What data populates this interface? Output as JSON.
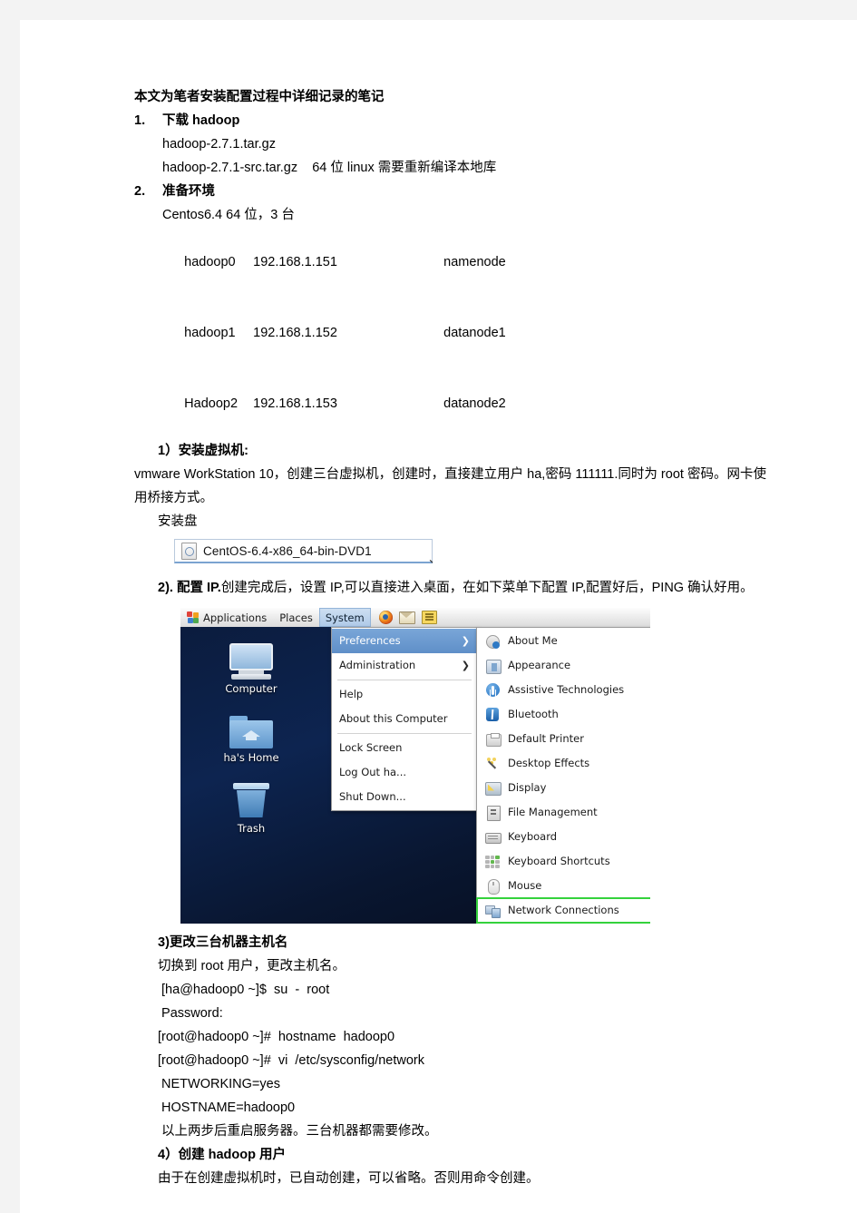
{
  "document": {
    "intro": "本文为笔者安装配置过程中详细记录的笔记",
    "sections": [
      {
        "number": "1.",
        "title": "下载 hadoop",
        "lines": [
          "hadoop-2.7.1.tar.gz",
          "hadoop-2.7.1-src.tar.gz    64 位 linux 需要重新编译本地库"
        ]
      },
      {
        "number": "2.",
        "title": "准备环境",
        "lines": [
          "Centos6.4 64 位，3 台"
        ]
      }
    ],
    "hosts": [
      {
        "name": "hadoop0",
        "ip": "192.168.1.151",
        "role": "namenode"
      },
      {
        "name": "hadoop1",
        "ip": "192.168.1.152",
        "role": "datanode1"
      },
      {
        "name": "Hadoop2",
        "ip": "192.168.1.153",
        "role": "datanode2"
      }
    ],
    "step1": {
      "heading": "1）安装虚拟机:",
      "para": "  vmware  WorkStation  10，创建三台虚拟机，创建时，直接建立用户  ha,密码 111111.同时为 root 密码。网卡使用桥接方式。",
      "disc_label": "安装盘",
      "iso_name": "CentOS-6.4-x86_64-bin-DVD1",
      "iso_tick": "、"
    },
    "step2": {
      "heading_bold": "2). 配置 IP.",
      "para": "创建完成后，设置 IP,可以直接进入桌面，在如下菜单下配置 IP,配置好后，PING 确认好用。"
    },
    "step3": {
      "heading": "3)更改三台机器主机名",
      "lines": [
        "切换到 root 用户，更改主机名。",
        " [ha@hadoop0 ~]$  su  -  root",
        " Password:",
        "[root@hadoop0 ~]#  hostname  hadoop0",
        "[root@hadoop0 ~]#  vi  /etc/sysconfig/network",
        " NETWORKING=yes",
        " HOSTNAME=hadoop0",
        " 以上两步后重启服务器。三台机器都需要修改。"
      ]
    },
    "step4": {
      "heading": "4）创建 hadoop 用户",
      "line": "由于在创建虚拟机时，已自动创建，可以省略。否则用命令创建。"
    }
  },
  "screenshot": {
    "panel": {
      "applications": "Applications",
      "places": "Places",
      "system": "System",
      "launchers": [
        "firefox-icon",
        "mail-icon",
        "text-editor-icon"
      ]
    },
    "desktop_icons": [
      {
        "label": "Computer",
        "icon": "computer-icon"
      },
      {
        "label": "ha's Home",
        "icon": "home-folder-icon"
      },
      {
        "label": "Trash",
        "icon": "trash-icon"
      }
    ],
    "system_menu": [
      {
        "label": "Preferences",
        "submenu": true,
        "highlighted": true
      },
      {
        "label": "Administration",
        "submenu": true,
        "highlighted": false
      },
      {
        "separator": true
      },
      {
        "label": "Help",
        "submenu": false,
        "highlighted": false
      },
      {
        "label": "About this Computer",
        "submenu": false,
        "highlighted": false
      },
      {
        "separator": true
      },
      {
        "label": "Lock Screen",
        "submenu": false,
        "highlighted": false
      },
      {
        "label": "Log Out ha...",
        "submenu": false,
        "highlighted": false
      },
      {
        "label": "Shut Down...",
        "submenu": false,
        "highlighted": false
      }
    ],
    "preferences_menu": [
      {
        "label": "About Me",
        "icon": "about-me-icon"
      },
      {
        "label": "Appearance",
        "icon": "appearance-icon"
      },
      {
        "label": "Assistive Technologies",
        "icon": "assistive-technologies-icon"
      },
      {
        "label": "Bluetooth",
        "icon": "bluetooth-icon"
      },
      {
        "label": "Default Printer",
        "icon": "printer-icon"
      },
      {
        "label": "Desktop Effects",
        "icon": "desktop-effects-icon"
      },
      {
        "label": "Display",
        "icon": "display-icon"
      },
      {
        "label": "File Management",
        "icon": "file-management-icon"
      },
      {
        "label": "Keyboard",
        "icon": "keyboard-icon"
      },
      {
        "label": "Keyboard Shortcuts",
        "icon": "keyboard-shortcuts-icon"
      },
      {
        "label": "Mouse",
        "icon": "mouse-icon"
      },
      {
        "label": "Network Connections",
        "icon": "network-connections-icon",
        "highlight_box": "#34d23c"
      }
    ]
  }
}
